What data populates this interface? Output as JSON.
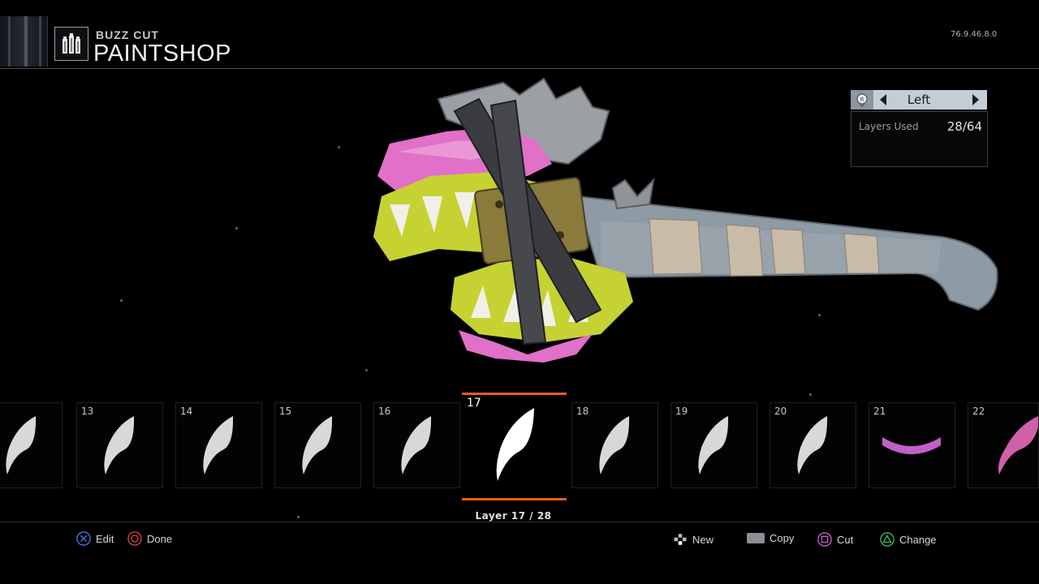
{
  "header": {
    "subtitle": "BUZZ CUT",
    "title": "PAINTSHOP",
    "version": "76.9.46.8.0",
    "icon": "paintshop-cans-icon"
  },
  "side_panel": {
    "selected_side": "Left",
    "layers_used_label": "Layers Used",
    "layers_used_value": "28/64",
    "button_icon": "r-stick-icon"
  },
  "layers": {
    "counter": "Layer 17 / 28",
    "selected": "17",
    "tiles": [
      {
        "number": "",
        "icon": "claw-decal-icon",
        "color": "#d8d8d8"
      },
      {
        "number": "13",
        "icon": "claw-decal-icon",
        "color": "#d8d8d8"
      },
      {
        "number": "14",
        "icon": "claw-decal-icon",
        "color": "#d8d8d8"
      },
      {
        "number": "15",
        "icon": "claw-decal-icon",
        "color": "#d8d8d8"
      },
      {
        "number": "16",
        "icon": "claw-decal-icon",
        "color": "#d8d8d8"
      },
      {
        "number": "17",
        "icon": "claw-decal-icon",
        "color": "#ffffff"
      },
      {
        "number": "18",
        "icon": "claw-decal-icon",
        "color": "#d8d8d8"
      },
      {
        "number": "19",
        "icon": "claw-decal-icon",
        "color": "#d8d8d8"
      },
      {
        "number": "20",
        "icon": "claw-decal-icon",
        "color": "#d8d8d8"
      },
      {
        "number": "21",
        "icon": "arc-decal-icon",
        "color": "#c060c8"
      },
      {
        "number": "22",
        "icon": "claw-decal-icon",
        "color": "#d060a8"
      }
    ]
  },
  "footer": {
    "edit": "Edit",
    "done": "Done",
    "new": "New",
    "copy": "Copy",
    "cut": "Cut",
    "change": "Change"
  },
  "colors": {
    "selection": "#f05a1c",
    "cross": "#4a7ad8",
    "circle": "#d84040",
    "square": "#c860c8",
    "triangle": "#40b860"
  }
}
